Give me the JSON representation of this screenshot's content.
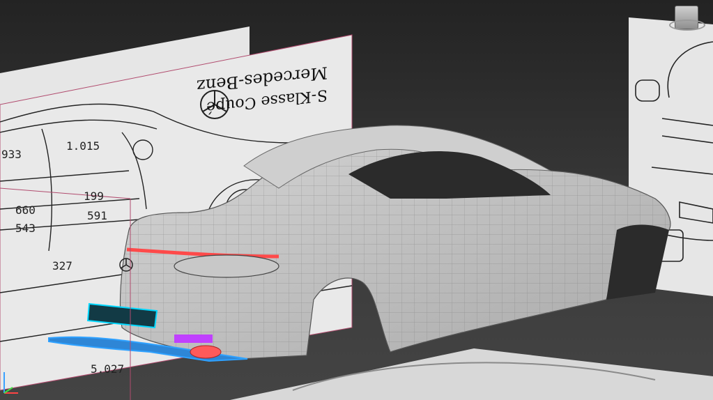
{
  "viewport": {
    "background": "#2b2b2b",
    "accent_selected": "#2ea1ff",
    "accent_tail_light": "#ff4a4a",
    "accent_magenta": "#c040ff",
    "accent_cyan": "#00d8ff"
  },
  "blueprint": {
    "brand_line1": "Mercedes-Benz",
    "brand_line2": "S-Klasse Coupé",
    "dimensions": [
      "933",
      "1.015",
      "660",
      "543",
      "199",
      "591",
      "327",
      "5.027"
    ]
  },
  "icons": {
    "viewcube": "viewcube-icon",
    "axis_tripod": "axis-tripod-icon",
    "logo": "mercedes-star-icon"
  }
}
